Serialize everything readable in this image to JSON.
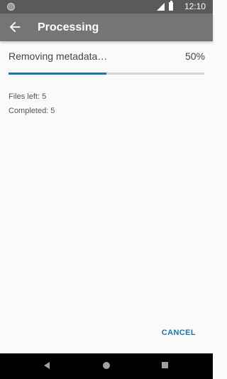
{
  "status_bar": {
    "time": "12:10",
    "left_icon": "notification-dot-icon",
    "signal_icon": "cell-signal-icon",
    "battery_icon": "battery-icon"
  },
  "toolbar": {
    "back_icon": "arrow-back-icon",
    "title": "Processing"
  },
  "task": {
    "label": "Removing metadata…",
    "percent_text": "50%",
    "progress": 0.5
  },
  "stats": {
    "files_left": "Files left: 5",
    "completed": "Completed: 5"
  },
  "actions": {
    "cancel_label": "CANCEL"
  },
  "nav_bar": {
    "back_icon": "nav-back-icon",
    "home_icon": "nav-home-icon",
    "recent_icon": "nav-recent-apps-icon"
  },
  "colors": {
    "accent": "#1a75a8",
    "toolbar": "#757575",
    "status_bar": "#5a5a5a",
    "background": "#fafafa"
  }
}
